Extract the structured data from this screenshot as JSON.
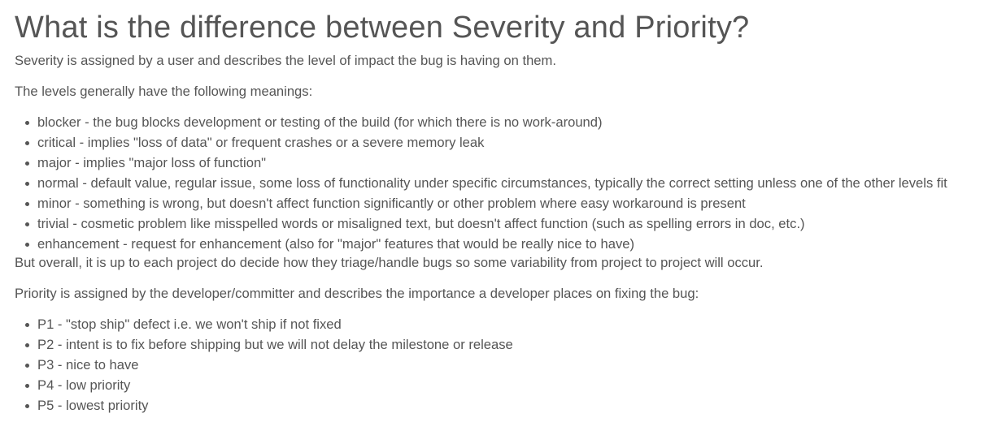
{
  "heading": "What is the difference between Severity and Priority?",
  "severity_intro": "Severity is assigned by a user and describes the level of impact the bug is having on them.",
  "levels_intro": "The levels generally have the following meanings:",
  "severity_levels": [
    "blocker - the bug blocks development or testing of the build (for which there is no work-around)",
    "critical - implies \"loss of data\" or frequent crashes or a severe memory leak",
    "major - implies \"major loss of function\"",
    "normal - default value, regular issue, some loss of functionality under specific circumstances, typically the correct setting unless one of the other levels fit",
    "minor - something is wrong, but doesn't affect function significantly or other problem where easy workaround is present",
    "trivial - cosmetic problem like misspelled words or misaligned text, but doesn't affect function (such as spelling errors in doc, etc.)",
    "enhancement - request for enhancement (also for \"major\" features that would be really nice to have)"
  ],
  "overall_note": "But overall, it is up to each project do decide how they triage/handle bugs so some variability from project to project will occur.",
  "priority_intro": "Priority is assigned by the developer/committer and describes the importance a developer places on fixing the bug:",
  "priority_levels": [
    "P1 - \"stop ship\" defect i.e. we won't ship if not fixed",
    "P2 - intent is to fix before shipping but we will not delay the milestone or release",
    "P3 - nice to have",
    "P4 - low priority",
    "P5 - lowest priority"
  ]
}
